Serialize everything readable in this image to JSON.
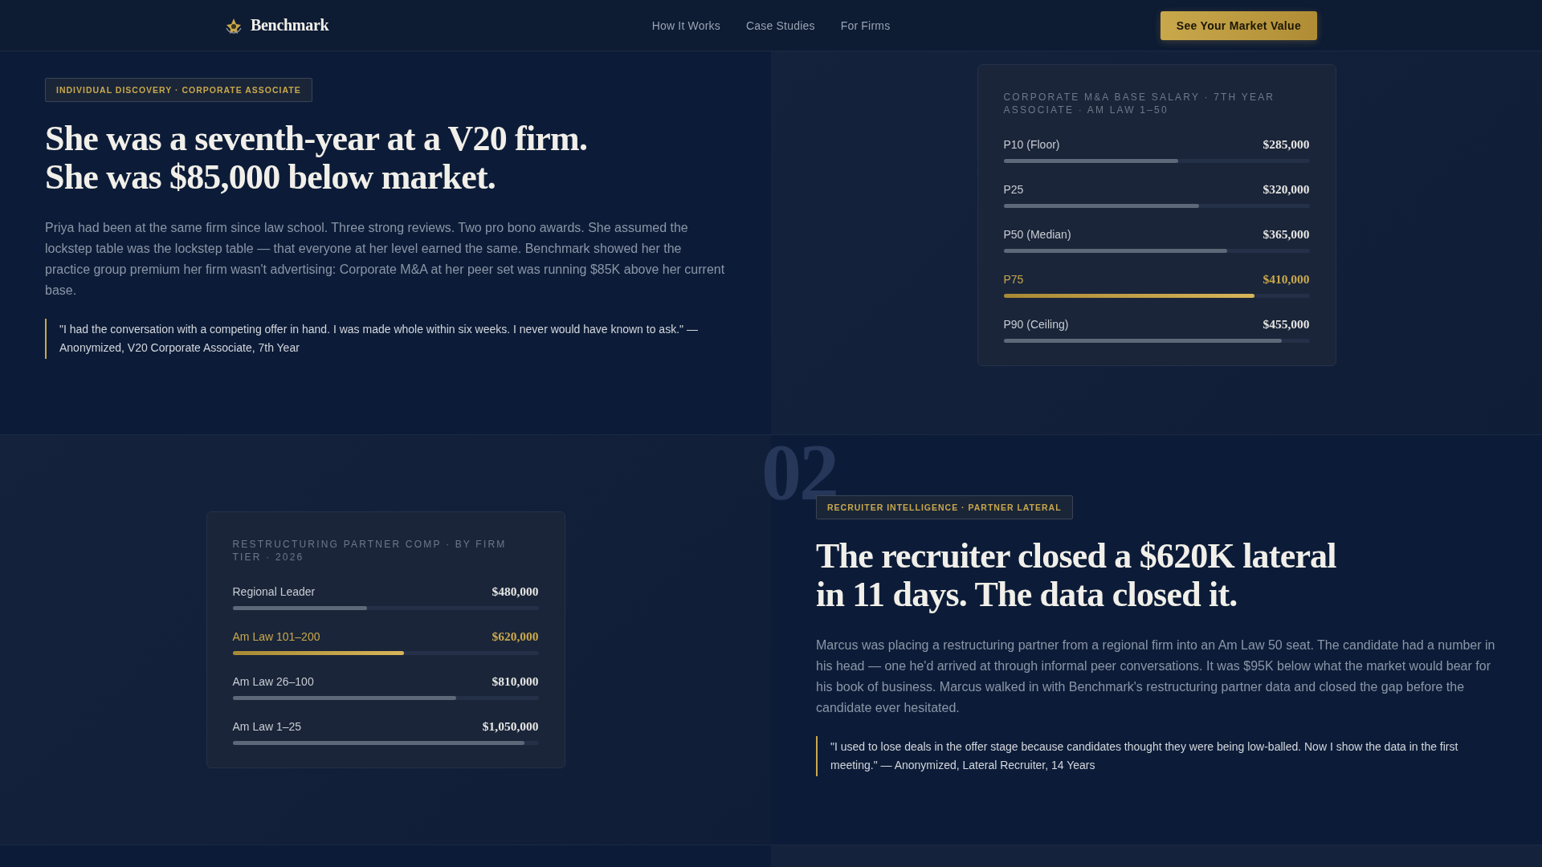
{
  "nav": {
    "brand": "Benchmark",
    "links": [
      "How It Works",
      "Case Studies",
      "For Firms"
    ],
    "cta": "See Your Market Value"
  },
  "stories": [
    {
      "kind": "standard",
      "tag": "INDIVIDUAL DISCOVERY · CORPORATE ASSOCIATE",
      "headline": [
        "She was a seventh-year at a V20 firm.",
        "She was $85,000 below market."
      ],
      "body": "Priya had been at the same firm since law school. Three strong reviews. Two pro bono awards. She assumed the lockstep table was the lockstep table — that everyone at her level earned the same. Benchmark showed her the practice group premium her firm wasn't advertising: Corporate M&A at her peer set was running $85K above her current base.",
      "quote": "\"I had the conversation with a competing offer in hand. I was made whole within six weeks. I never would have known to ask.\" — Anonymized, V20 Corporate Associate, 7th Year",
      "card": {
        "title": "CORPORATE M&A BASE SALARY · 7TH YEAR ASSOCIATE · AM LAW 1–50",
        "rows": [
          {
            "label": "P10 (Floor)",
            "value": "$285,000",
            "level": 0.57,
            "highlighted": false
          },
          {
            "label": "P25",
            "value": "$320,000",
            "level": 0.64,
            "highlighted": false
          },
          {
            "label": "P50 (Median)",
            "value": "$365,000",
            "level": 0.73,
            "highlighted": false
          },
          {
            "label": "P75",
            "value": "$410,000",
            "level": 0.82,
            "highlighted": true
          },
          {
            "label": "P90 (Ceiling)",
            "value": "$455,000",
            "level": 0.91,
            "highlighted": false
          }
        ]
      }
    },
    {
      "number": "02",
      "kind": "mirrored",
      "tag": "RECRUITER INTELLIGENCE · PARTNER LATERAL",
      "headline": [
        "The recruiter closed a $620K lateral",
        "in 11 days. The data closed it."
      ],
      "body": "Marcus was placing a restructuring partner from a regional firm into an Am Law 50 seat. The candidate had a number in his head — one he'd arrived at through informal peer conversations. It was $95K below what the market would bear for his book of business. Marcus walked in with Benchmark's restructuring partner data and closed the gap before the candidate ever hesitated.",
      "quote": "\"I used to lose deals in the offer stage because candidates thought they were being low-balled. Now I show the data in the first meeting.\" — Anonymized, Lateral Recruiter, 14 Years",
      "card": {
        "title": "RESTRUCTURING PARTNER COMP · BY FIRM TIER · 2026",
        "rows": [
          {
            "label": "Regional Leader",
            "value": "$480,000",
            "level": 0.44,
            "highlighted": false
          },
          {
            "label": "Am Law 101–200",
            "value": "$620,000",
            "level": 0.56,
            "highlighted": true
          },
          {
            "label": "Am Law 26–100",
            "value": "$810,000",
            "level": 0.73,
            "highlighted": false
          },
          {
            "label": "Am Law 1–25",
            "value": "$1,050,000",
            "level": 0.955,
            "highlighted": false
          }
        ]
      }
    }
  ]
}
